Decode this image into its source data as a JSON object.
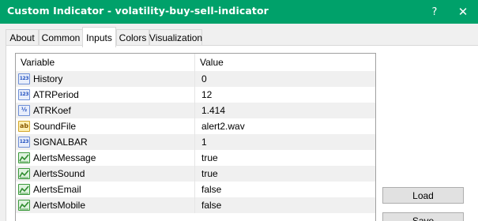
{
  "window": {
    "title": "Custom Indicator - volatility-buy-sell-indicator",
    "help_glyph": "?",
    "close_glyph": "✕",
    "title_bar_color": "#00a16a"
  },
  "tabs": [
    {
      "label": "About",
      "active": false
    },
    {
      "label": "Common",
      "active": false
    },
    {
      "label": "Inputs",
      "active": true
    },
    {
      "label": "Colors",
      "active": false
    },
    {
      "label": "Visualization",
      "active": false
    }
  ],
  "grid": {
    "headers": {
      "variable": "Variable",
      "value": "Value"
    },
    "rows": [
      {
        "icon": "int-icon",
        "icon_text": "123",
        "name": "History",
        "value": "0"
      },
      {
        "icon": "int-icon",
        "icon_text": "123",
        "name": "ATRPeriod",
        "value": "12"
      },
      {
        "icon": "double-icon",
        "icon_text": "½",
        "name": "ATRKoef",
        "value": "1.414"
      },
      {
        "icon": "string-icon",
        "icon_text": "ab",
        "name": "SoundFile",
        "value": "alert2.wav"
      },
      {
        "icon": "int-icon",
        "icon_text": "123",
        "name": "SIGNALBAR",
        "value": "1"
      },
      {
        "icon": "bool-icon",
        "icon_text": "",
        "name": "AlertsMessage",
        "value": "true"
      },
      {
        "icon": "bool-icon",
        "icon_text": "",
        "name": "AlertsSound",
        "value": "true"
      },
      {
        "icon": "bool-icon",
        "icon_text": "",
        "name": "AlertsEmail",
        "value": "false"
      },
      {
        "icon": "bool-icon",
        "icon_text": "",
        "name": "AlertsMobile",
        "value": "false"
      }
    ]
  },
  "buttons": {
    "load": "Load",
    "save": "Save"
  }
}
